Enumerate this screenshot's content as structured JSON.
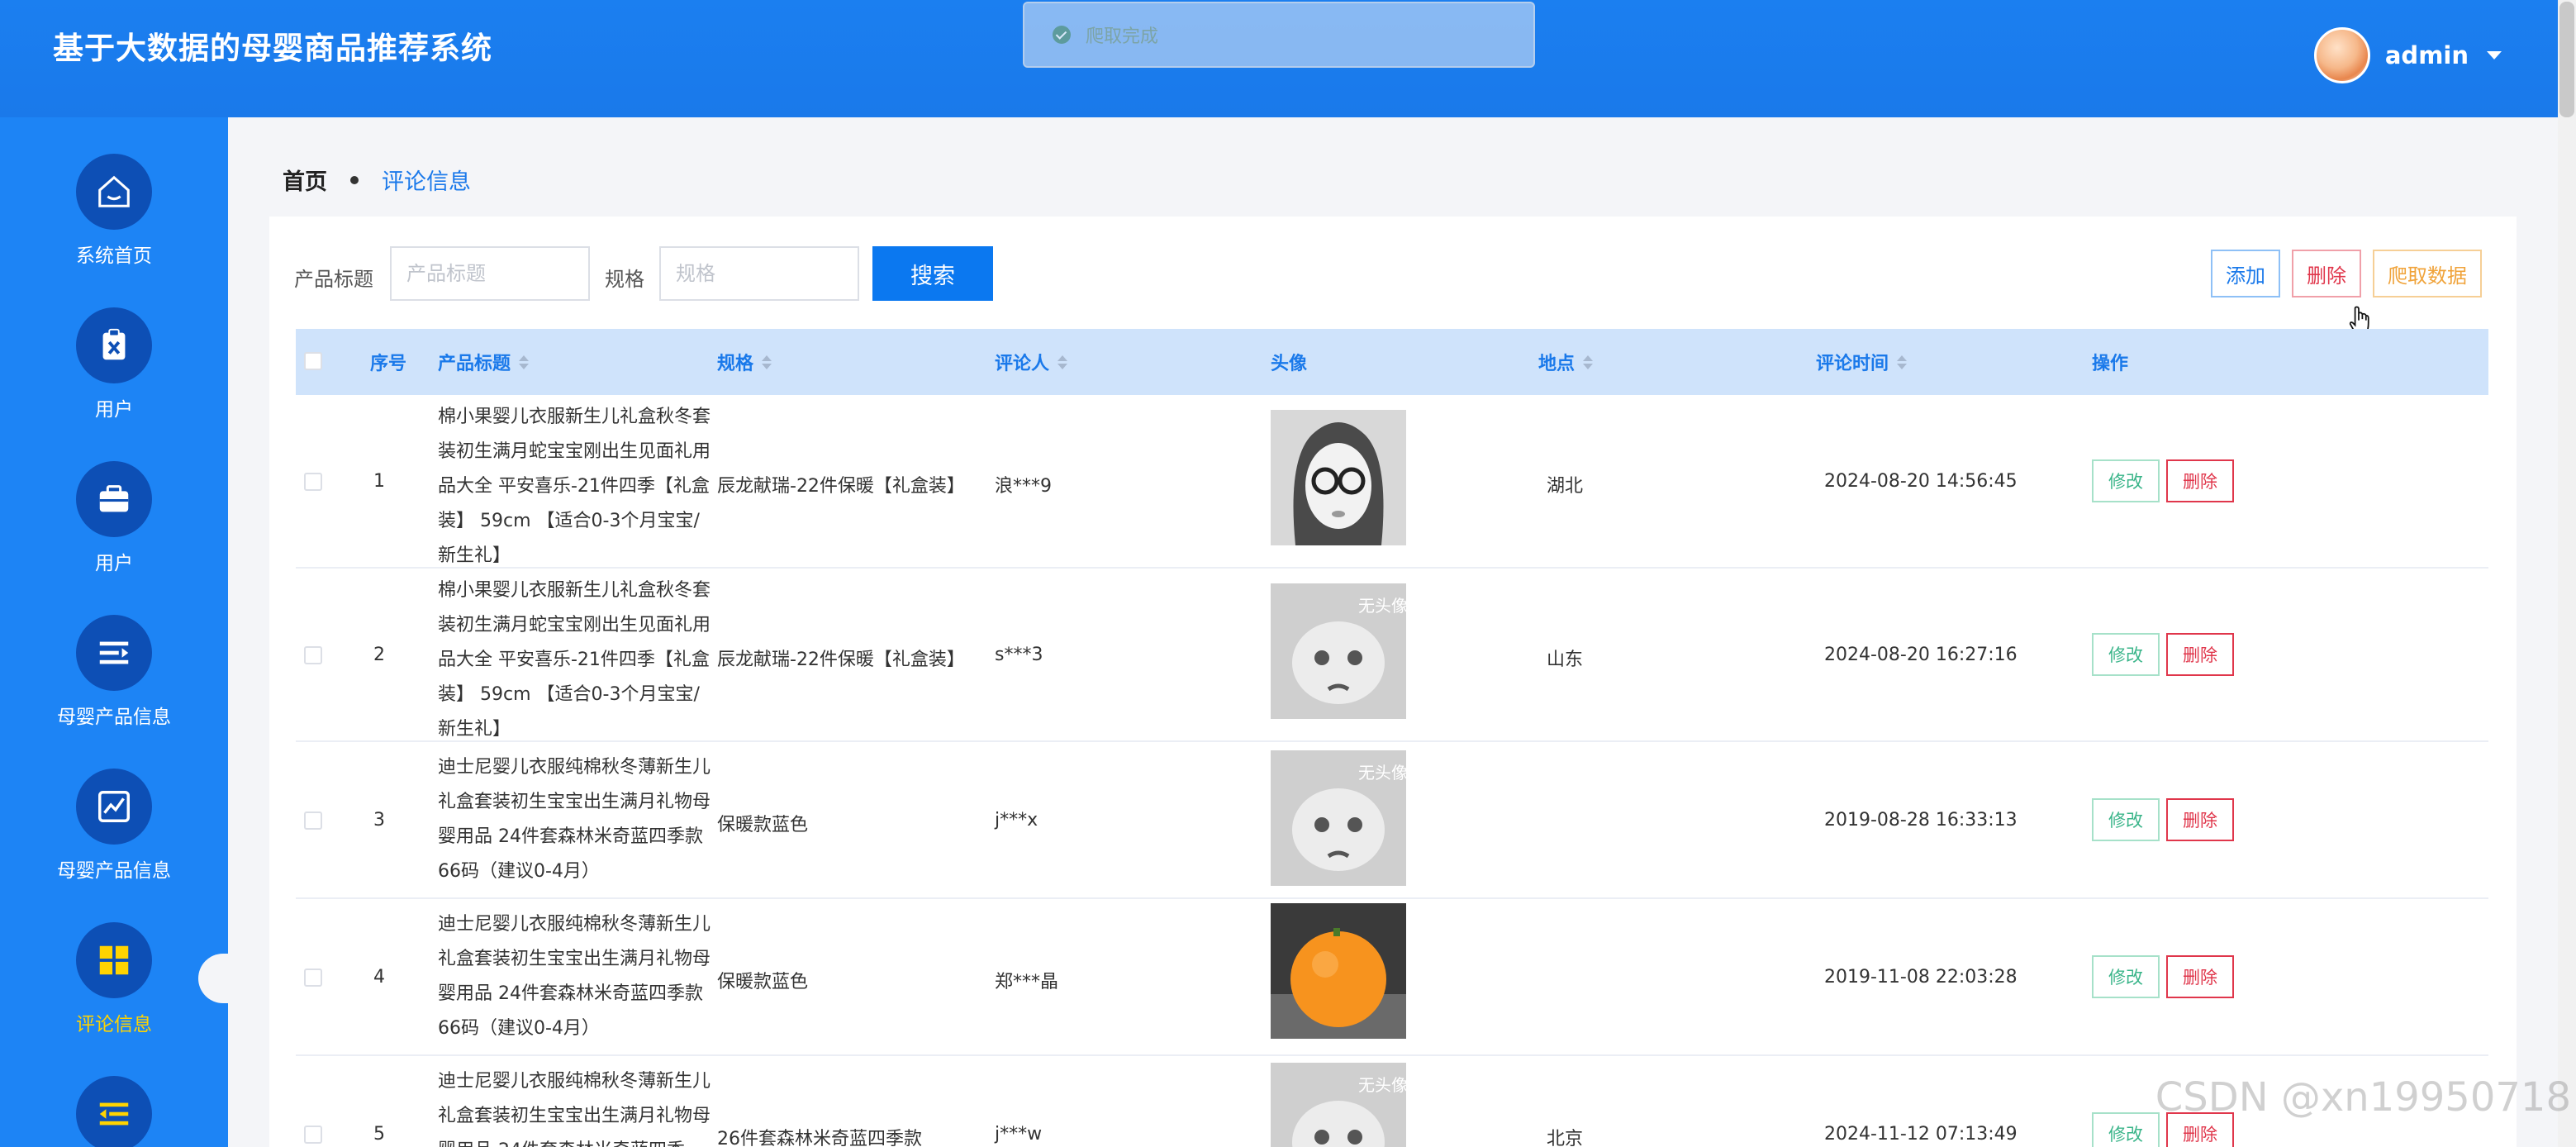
{
  "header": {
    "app_title": "基于大数据的母婴商品推荐系统",
    "user_name": "admin"
  },
  "toast": {
    "text": "爬取完成"
  },
  "sidebar": {
    "items": [
      {
        "label": "系统首页",
        "icon": "home-icon"
      },
      {
        "label": "用户",
        "icon": "user-clipboard-icon"
      },
      {
        "label": "用户",
        "icon": "briefcase-icon"
      },
      {
        "label": "母婴产品信息",
        "icon": "list-icon"
      },
      {
        "label": "母婴产品信息",
        "icon": "chart-icon"
      },
      {
        "label": "评论信息",
        "icon": "grid-icon",
        "active": true
      },
      {
        "label": "",
        "icon": "menu-icon"
      }
    ]
  },
  "breadcrumb": {
    "home": "首页",
    "current": "评论信息"
  },
  "filters": {
    "title_label": "产品标题",
    "title_placeholder": "产品标题",
    "spec_label": "规格",
    "spec_placeholder": "规格",
    "search_button": "搜索"
  },
  "toolbar": {
    "add": "添加",
    "delete": "删除",
    "crawl": "爬取数据"
  },
  "table": {
    "headers": {
      "index": "序号",
      "title": "产品标题",
      "spec": "规格",
      "reviewer": "评论人",
      "avatar": "头像",
      "location": "地点",
      "time": "评论时间",
      "actions": "操作"
    },
    "edit_label": "修改",
    "delete_label": "删除",
    "rows": [
      {
        "index": "1",
        "title": "棉小果婴儿衣服新生儿礼盒秋冬套装初生满月蛇宝宝刚出生见面礼用品大全 平安喜乐-21件四季【礼盒装】 59cm 【适合0-3个月宝宝/新生礼】",
        "spec": "辰龙献瑞-22件保暖【礼盒装】",
        "reviewer": "浪***9",
        "avatar": "sketch-girl",
        "location": "湖北",
        "time": "2024-08-20 14:56:45"
      },
      {
        "index": "2",
        "title": "棉小果婴儿衣服新生儿礼盒秋冬套装初生满月蛇宝宝刚出生见面礼用品大全 平安喜乐-21件四季【礼盒装】 59cm 【适合0-3个月宝宝/新生礼】",
        "spec": "辰龙献瑞-22件保暖【礼盒装】",
        "reviewer": "s***3",
        "avatar": "default",
        "location": "山东",
        "time": "2024-08-20 16:27:16"
      },
      {
        "index": "3",
        "title": "迪士尼婴儿衣服纯棉秋冬薄新生儿礼盒套装初生宝宝出生满月礼物母婴用品 24件套森林米奇蓝四季款 66码（建议0-4月）",
        "spec": "保暖款蓝色",
        "reviewer": "j***x",
        "avatar": "default",
        "location": "",
        "time": "2019-08-28 16:33:13"
      },
      {
        "index": "4",
        "title": "迪士尼婴儿衣服纯棉秋冬薄新生儿礼盒套装初生宝宝出生满月礼物母婴用品 24件套森林米奇蓝四季款 66码（建议0-4月）",
        "spec": "保暖款蓝色",
        "reviewer": "郑***晶",
        "avatar": "orange",
        "location": "",
        "time": "2019-11-08 22:03:28"
      },
      {
        "index": "5",
        "title": "迪士尼婴儿衣服纯棉秋冬薄新生儿礼盒套装初生宝宝出生满月礼物母婴用品 24件套森林米奇蓝四季",
        "spec": "26件套森林米奇蓝四季款",
        "reviewer": "j***w",
        "avatar": "default",
        "location": "北京",
        "time": "2024-11-12 07:13:49"
      }
    ]
  },
  "avatar_default_text": "无头像",
  "watermark": "CSDN @xn19950718",
  "colors": {
    "header_blue": "#1a79ea",
    "sidebar_blue": "#1d84f5",
    "nav_circle": "#0d4fb5",
    "active_yellow": "#ffd400",
    "delete_red": "#e0364b",
    "edit_green": "#3bb58a",
    "crawl_orange": "#f0a33a"
  }
}
